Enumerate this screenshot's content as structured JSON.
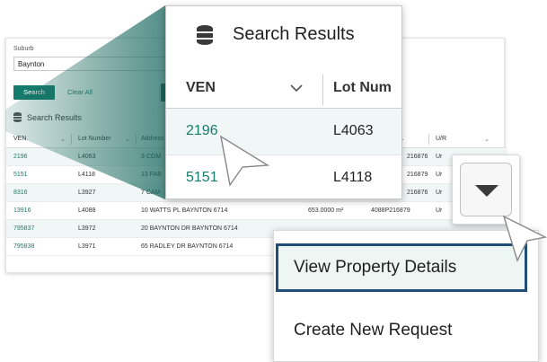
{
  "search": {
    "suburb_label": "Suburb",
    "suburb_value": "Baynton",
    "search_button": "Search",
    "clear_button": "Clear All"
  },
  "results": {
    "title": "Search Results",
    "columns": [
      "VEN",
      "Lot Number",
      "Address",
      "L...",
      "U/R"
    ],
    "rows": [
      {
        "ven": "2196",
        "lot": "L4063",
        "address": "3 COM",
        "area": "",
        "pin": "216876",
        "ur": "Ur"
      },
      {
        "ven": "5151",
        "lot": "L4118",
        "address": "13 FAB",
        "area": "",
        "pin": "216879",
        "ur": "Ur"
      },
      {
        "ven": "8316",
        "lot": "L3927",
        "address": "7 CAM",
        "area": "",
        "pin": "216876",
        "ur": "Ur"
      },
      {
        "ven": "13916",
        "lot": "L4088",
        "address": "10 WATTS PL BAYNTON 6714",
        "area": "653.0000 m²",
        "pin": "4088P216879",
        "ur": "Ur"
      },
      {
        "ven": "795837",
        "lot": "L3972",
        "address": "20 BAYNTON DR BAYNTON 6714",
        "area": "",
        "pin": "",
        "ur": ""
      },
      {
        "ven": "795838",
        "lot": "L3971",
        "address": "65 RADLEY DR BAYNTON 6714",
        "area": "",
        "pin": "",
        "ur": ""
      }
    ]
  },
  "zoom": {
    "title": "Search Results",
    "col_ven": "VEN",
    "col_lot": "Lot Num",
    "rows": [
      {
        "ven": "2196",
        "lot": "L4063"
      },
      {
        "ven": "5151",
        "lot": "L4118"
      }
    ]
  },
  "menu": {
    "items": [
      "View Property Details",
      "Create New Request"
    ]
  },
  "colors": {
    "accent": "#157b6c",
    "dark_accent": "#1a4d44",
    "highlight_border": "#1f4e79"
  }
}
